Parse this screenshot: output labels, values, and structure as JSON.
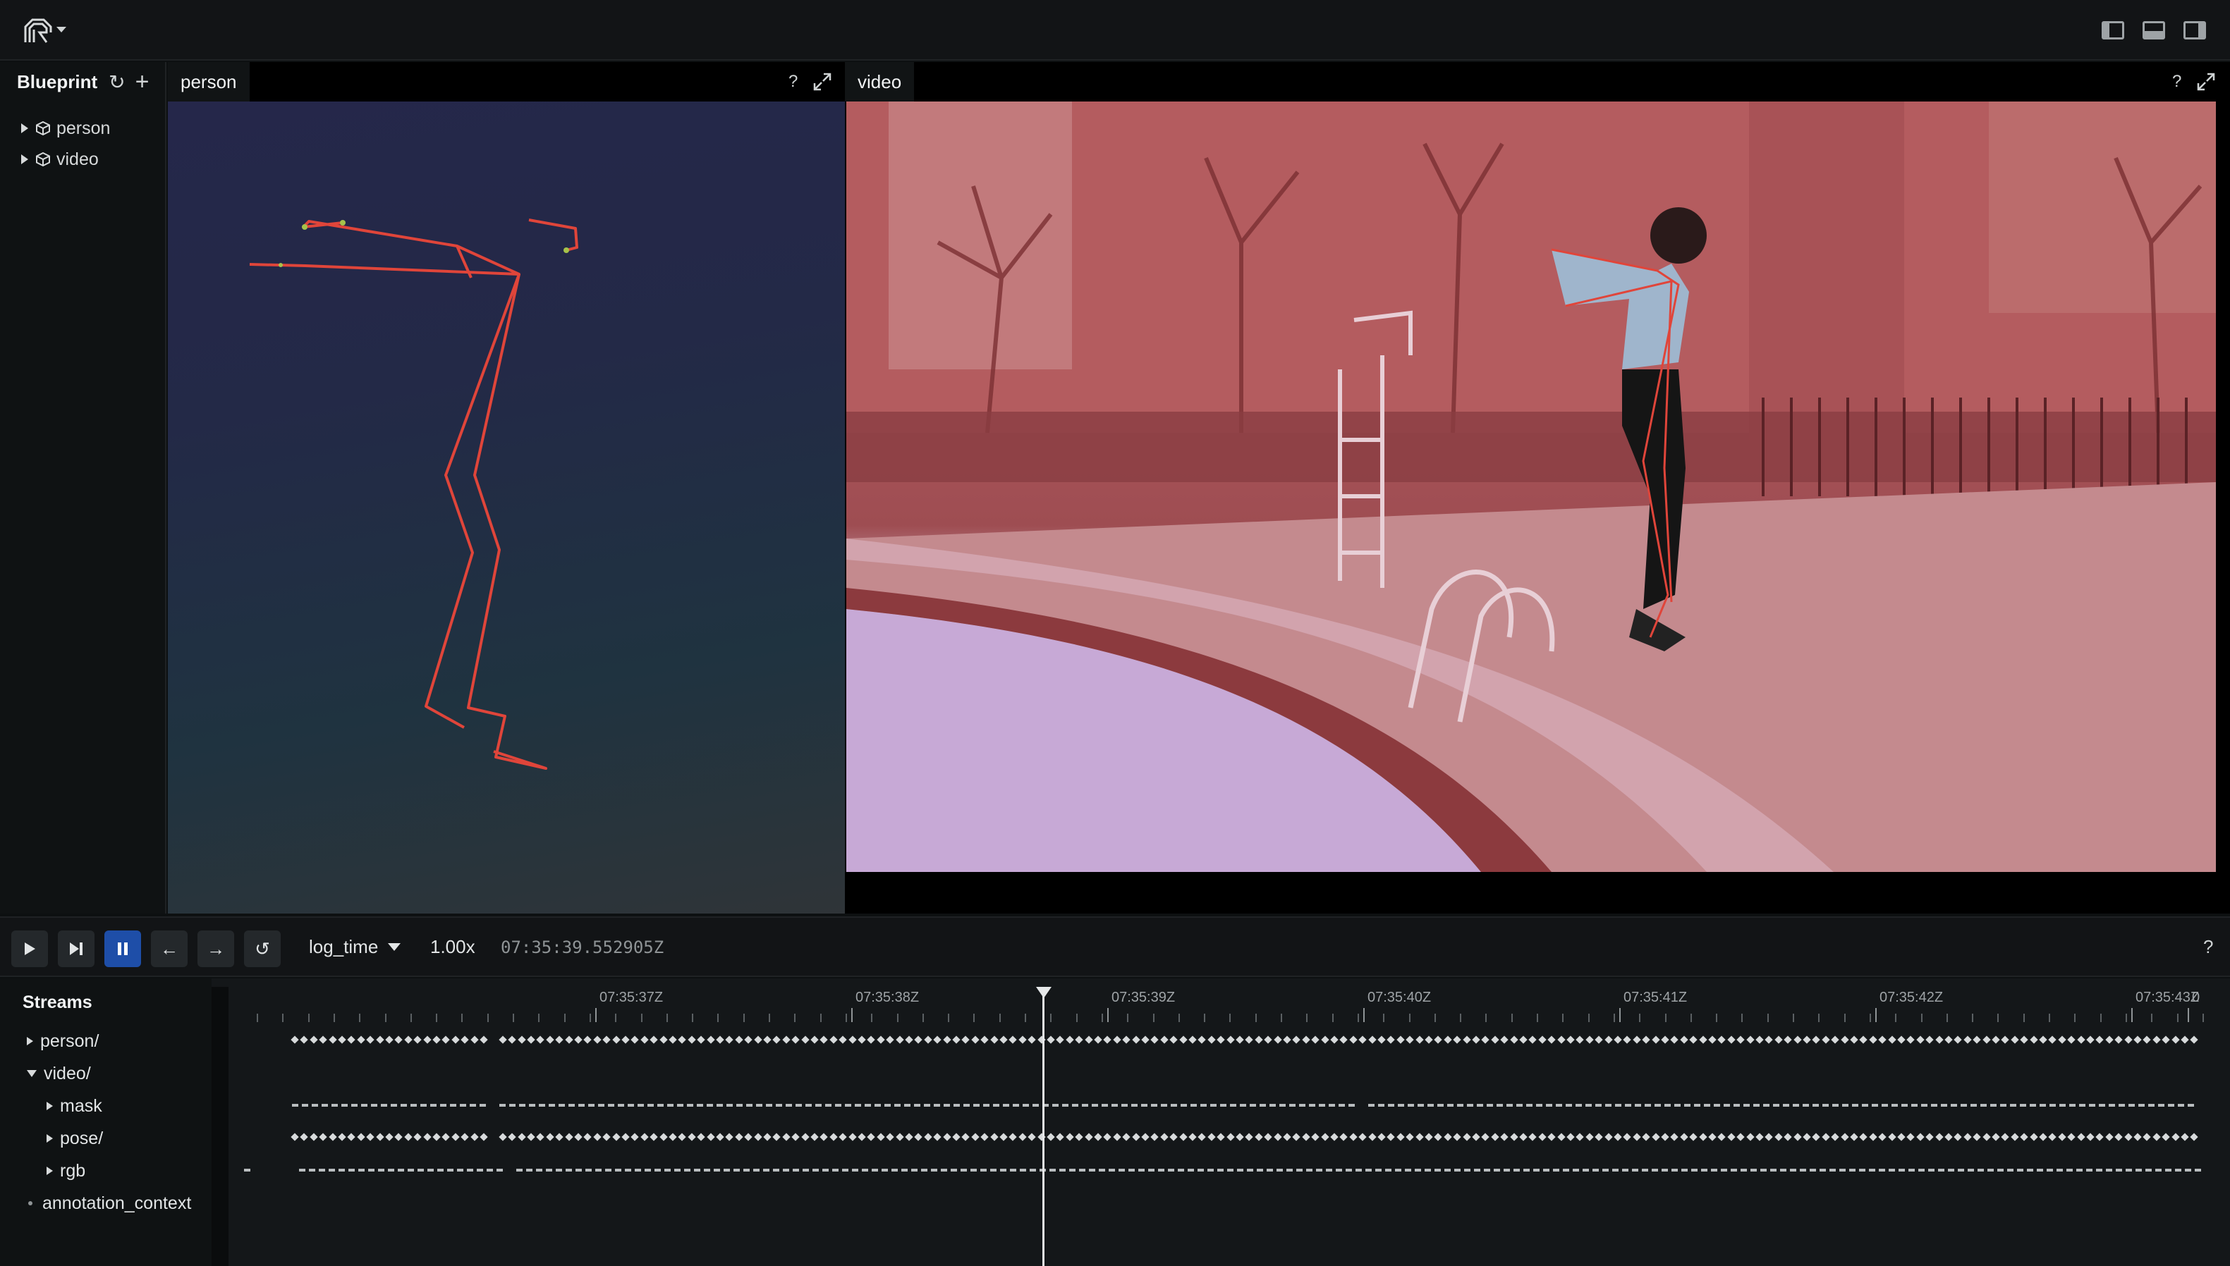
{
  "app": {
    "logo_icon": "rerun-logo-icon",
    "layout_buttons": [
      "left-panel-toggle-icon",
      "bottom-panel-toggle-icon",
      "right-panel-toggle-icon"
    ]
  },
  "blueprint": {
    "title": "Blueprint",
    "items": [
      {
        "label": "person",
        "icon": "cube-icon"
      },
      {
        "label": "video",
        "icon": "cube-icon"
      }
    ]
  },
  "views": {
    "person": {
      "title": "person",
      "help": "?",
      "maximize_icon": "expand-icon"
    },
    "video": {
      "title": "video",
      "help": "?",
      "maximize_icon": "expand-icon"
    }
  },
  "controls": {
    "timeline_name": "log_time",
    "speed": "1.00x",
    "current_time": "07:35:39.552905Z",
    "help": "?"
  },
  "streams": {
    "title": "Streams",
    "rows": [
      {
        "label": "person/",
        "expanded": false,
        "indent": 0
      },
      {
        "label": "video/",
        "expanded": true,
        "indent": 0
      },
      {
        "label": "mask",
        "expanded": false,
        "indent": 1
      },
      {
        "label": "pose/",
        "expanded": false,
        "indent": 1
      },
      {
        "label": "rgb",
        "expanded": false,
        "indent": 1
      },
      {
        "label": "annotation_context",
        "expanded": null,
        "indent": 0
      }
    ]
  },
  "timeline": {
    "tick_labels": [
      "07:35:37Z",
      "07:35:38Z",
      "07:35:39Z",
      "07:35:40Z",
      "07:35:41Z",
      "07:35:42Z",
      "07:35:43Z",
      "0"
    ]
  },
  "colors": {
    "accent": "#1e4ea8",
    "skeleton": "#e0453a",
    "keypoint": "#a6c24a"
  }
}
